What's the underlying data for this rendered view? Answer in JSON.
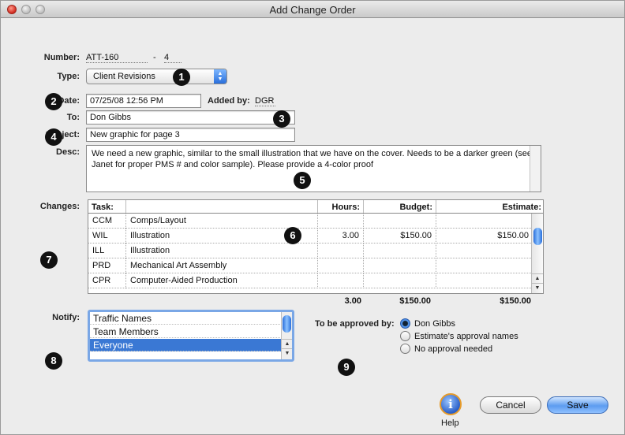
{
  "window": {
    "title": "Add Change Order"
  },
  "form": {
    "number_label": "Number:",
    "number_value": "ATT-160",
    "number_sep": "-",
    "number_suffix": "4",
    "type_label": "Type:",
    "type_value": "Client Revisions",
    "date_label": "Date:",
    "date_value": "07/25/08 12:56 PM",
    "added_by_label": "Added by:",
    "added_by_value": "DGR",
    "to_label": "To:",
    "to_value": "Don Gibbs",
    "subject_label": "Subject:",
    "subject_value": "New graphic for page 3",
    "desc_label": "Desc:",
    "desc_value": "We need a new graphic, similar to the small illustration that we have on the cover. Needs to be a darker green (see Janet for proper PMS # and color sample).  Please provide a 4-color proof"
  },
  "changes": {
    "label": "Changes:",
    "columns": {
      "task": "Task:",
      "hours": "Hours:",
      "budget": "Budget:",
      "estimate": "Estimate:"
    },
    "rows": [
      {
        "code": "CCM",
        "name": "Comps/Layout",
        "hours": "",
        "budget": "",
        "estimate": ""
      },
      {
        "code": "WIL",
        "name": "Illustration",
        "hours": "3.00",
        "budget": "$150.00",
        "estimate": "$150.00"
      },
      {
        "code": "ILL",
        "name": "Illustration",
        "hours": "",
        "budget": "",
        "estimate": ""
      },
      {
        "code": "PRD",
        "name": "Mechanical Art Assembly",
        "hours": "",
        "budget": "",
        "estimate": ""
      },
      {
        "code": "CPR",
        "name": "Computer-Aided Production",
        "hours": "",
        "budget": "",
        "estimate": ""
      }
    ],
    "totals": {
      "hours": "3.00",
      "budget": "$150.00",
      "estimate": "$150.00"
    }
  },
  "notify": {
    "label": "Notify:",
    "items": [
      "Traffic Names",
      "Team Members",
      "Everyone"
    ],
    "selected": "Everyone"
  },
  "approval": {
    "label": "To be approved by:",
    "options": [
      "Don Gibbs",
      "Estimate's approval names",
      "No approval needed"
    ],
    "selected": "Don Gibbs"
  },
  "buttons": {
    "help": "Help",
    "cancel": "Cancel",
    "save": "Save"
  },
  "callouts": [
    "1",
    "2",
    "3",
    "4",
    "5",
    "6",
    "7",
    "8",
    "9"
  ]
}
